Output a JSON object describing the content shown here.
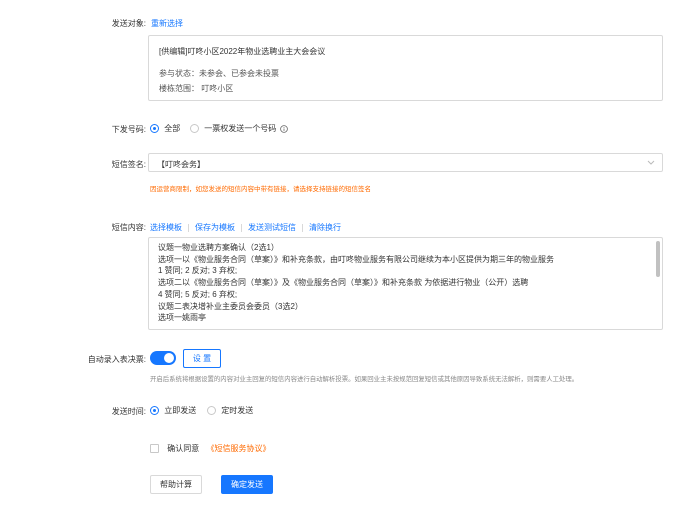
{
  "target": {
    "label": "发送对象:",
    "reselect": "重新选择",
    "title": "[供编辑]叮咚小区2022年物业选聘业主大会会议",
    "status": "参与状态：未参会、已参会未投票",
    "scope": "楼栋范围：  叮咚小区"
  },
  "issue": {
    "label": "下发号码:",
    "options": [
      "全部",
      "一票权发送一个号码"
    ],
    "info_icon": "info-circle-icon"
  },
  "signature": {
    "label": "短信签名:",
    "value": "【叮咚会务】",
    "warning": "因运营商限制，如您发送的短信内容中带有链接，请选择支持链接的短信签名"
  },
  "content": {
    "label": "短信内容:",
    "actions": [
      "选择模板",
      "保存为模板",
      "发送测试短信",
      "清除换行"
    ],
    "lines": [
      "议题一物业选聘方案确认（2选1）",
      "选项一以《物业服务合同（草案）》和补充条款，由叮咚物业服务有限公司继续为本小区提供为期三年的物业服务",
      "1 赞同; 2 反对; 3 弃权;",
      "选项二以《物业服务合同（草案）》及《物业服务合同（草案）》和补充条款 为依据进行物业（公开）选聘",
      "4 赞同; 5 反对; 6 弃权;",
      "议题二表决增补业主委员会委员（3选2）",
      "选项一姚雨亭"
    ]
  },
  "auto_record": {
    "label": "自动录入表决票:",
    "settings_label": "设 置",
    "hint": "开启后系统将根据设置的内容对业主回复的短信内容进行自动解析投票。如果回业主未按规范回复短信或其他原因导致系统无法解析，则需要人工处理。"
  },
  "send_time": {
    "label": "发送时间:",
    "options": [
      "立即发送",
      "定时发送"
    ]
  },
  "agreement": {
    "text": "确认同意",
    "link": "《短信服务协议》"
  },
  "buttons": {
    "help": "帮助计算",
    "send": "确定发送"
  },
  "colors": {
    "primary": "#1677ff",
    "warning": "#ff6a00"
  }
}
